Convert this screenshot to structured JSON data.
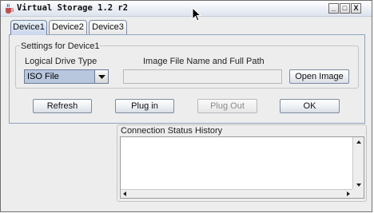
{
  "window": {
    "title": "Virtual Storage 1.2 r2",
    "controls": {
      "minimize": "_",
      "maximize": "□",
      "close": "X"
    }
  },
  "tabs": [
    {
      "label": "Device1",
      "active": true
    },
    {
      "label": "Device2",
      "active": false
    },
    {
      "label": "Device3",
      "active": false
    }
  ],
  "settings": {
    "group_title": "Settings for Device1",
    "drive_type_label": "Logical Drive Type",
    "drive_type_value": "ISO File",
    "image_path_label": "Image File Name and Full Path",
    "image_path_value": "",
    "open_image_button": "Open Image"
  },
  "actions": {
    "refresh": "Refresh",
    "plug_in": "Plug in",
    "plug_out": "Plug Out",
    "ok": "OK"
  },
  "status": {
    "title": "Connection Status History",
    "content": ""
  },
  "colors": {
    "combo_selected": "#b8c7dd",
    "tab_border": "#8fa3c0",
    "window_bg": "#ededed"
  }
}
